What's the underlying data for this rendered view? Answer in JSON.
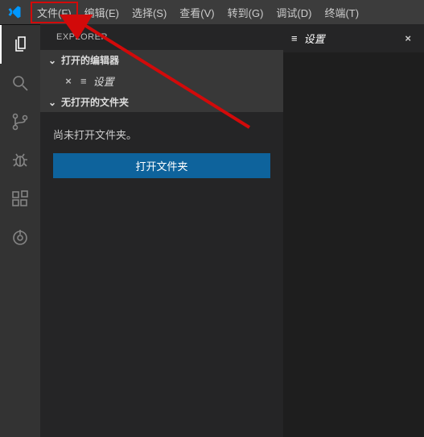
{
  "menu": {
    "file": "文件(F)",
    "edit": "编辑(E)",
    "selection": "选择(S)",
    "view": "查看(V)",
    "go": "转到(G)",
    "debug": "调试(D)",
    "terminal": "终端(T)"
  },
  "sidebar": {
    "title": "EXPLORER",
    "openEditors": "打开的编辑器",
    "settingsTab": "设置",
    "noFolder": "无打开的文件夹",
    "noFolderMsg": "尚未打开文件夹。",
    "openFolderBtn": "打开文件夹"
  },
  "editor": {
    "tabLabel": "设置"
  },
  "glyphs": {
    "chevDown": "⌄",
    "lines": "≡",
    "close": "×"
  }
}
